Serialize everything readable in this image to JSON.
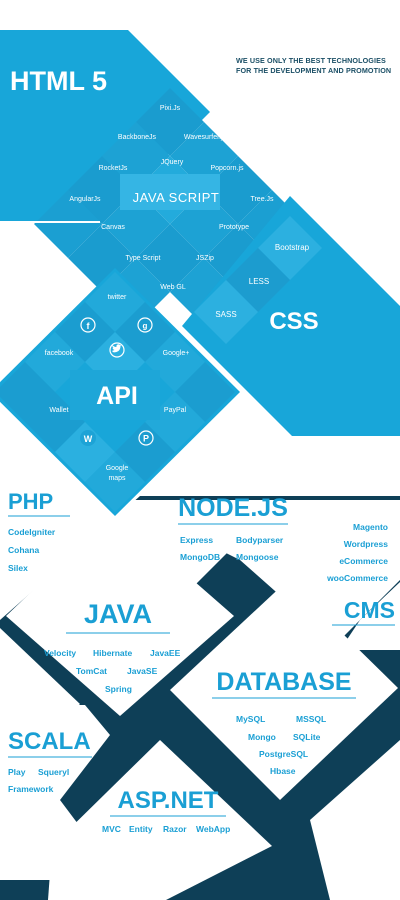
{
  "tagline": [
    "WE USE ONLY THE BEST TECHNOLOGIES",
    "FOR THE DEVELOPMENT AND PROMOTION"
  ],
  "html5": {
    "title": "HTML 5",
    "center": "JAVA SCRIPT",
    "items": [
      "Pixi.Js",
      "BackboneJs",
      "Wavesurfer.js",
      "JQuery",
      "RocketJs",
      "Popcorn.js",
      "AngularJs",
      "Tree.Js",
      "Canvas",
      "Prototype",
      "Type Script",
      "JSZip",
      "Web GL"
    ]
  },
  "css": {
    "title": "CSS",
    "items": [
      "Bootstrap",
      "LESS",
      "SASS"
    ]
  },
  "api": {
    "title": "API",
    "items": [
      "twitter",
      "facebook",
      "Google+",
      "Wallet",
      "PayPal",
      "Google maps"
    ],
    "icons": [
      "facebook-icon",
      "google-icon",
      "twitter-icon",
      "wallet-w-icon",
      "paypal-p-icon"
    ]
  },
  "php": {
    "title": "PHP",
    "items": [
      "CodeIgniter",
      "Cohana",
      "Silex"
    ]
  },
  "node": {
    "title": "NODE.JS",
    "items": [
      "Express",
      "Bodyparser",
      "MongoDB",
      "Mongoose"
    ]
  },
  "cms": {
    "title": "CMS",
    "items": [
      "Magento",
      "Wordpress",
      "eCommerce",
      "wooCommerce"
    ]
  },
  "java": {
    "title": "JAVA",
    "items": [
      "Velocity",
      "Hibernate",
      "JavaEE",
      "TomCat",
      "JavaSE",
      "Spring"
    ]
  },
  "database": {
    "title": "DATABASE",
    "items": [
      "MySQL",
      "MSSQL",
      "Mongo",
      "SQLite",
      "PostgreSQL",
      "Hbase"
    ]
  },
  "scala": {
    "title": "SCALA",
    "items": [
      "Play",
      "Squeryl",
      "Framework"
    ]
  },
  "aspnet": {
    "title": "ASP.NET",
    "items": [
      "MVC",
      "Entity",
      "Razor",
      "WebApp"
    ]
  },
  "colors": {
    "primary": "#18a6d9",
    "dark": "#0e3f57",
    "tile": "#1d9fd2",
    "tile_light": "#39b6e4"
  }
}
